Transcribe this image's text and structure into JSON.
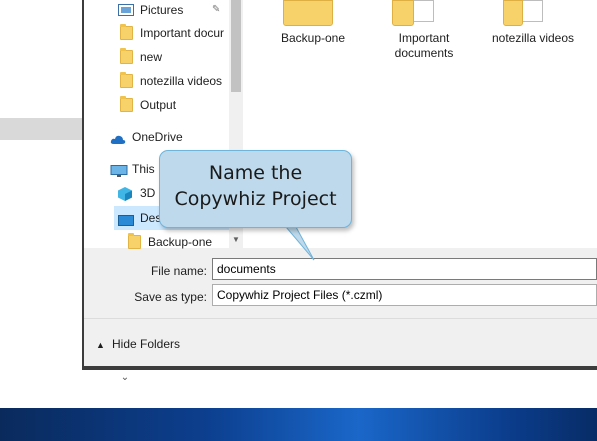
{
  "nav": {
    "items": [
      {
        "label": "Pictures",
        "icon": "pictures-icon",
        "pinned": true
      },
      {
        "label": "Important docur",
        "icon": "folder-icon"
      },
      {
        "label": "new",
        "icon": "folder-icon"
      },
      {
        "label": "notezilla videos",
        "icon": "folder-icon"
      },
      {
        "label": "Output",
        "icon": "folder-icon"
      },
      {
        "label": "OneDrive",
        "icon": "onedrive-icon"
      },
      {
        "label": "This",
        "icon": "this-pc-icon"
      },
      {
        "label": "3D",
        "icon": "3d-objects-icon"
      },
      {
        "label": "Des",
        "icon": "desktop-icon",
        "selected": true
      },
      {
        "label": "Backup-one",
        "icon": "folder-icon"
      }
    ]
  },
  "files": {
    "items": [
      {
        "label": "Backup-one"
      },
      {
        "label": "Important documents"
      },
      {
        "label": "notezilla videos"
      }
    ]
  },
  "form": {
    "filename_label": "File name:",
    "filename_value": "documents",
    "saveas_label": "Save as type:",
    "saveas_value": "Copywhiz Project Files (*.czml)"
  },
  "footer": {
    "hide_folders_label": "Hide Folders"
  },
  "callout": {
    "text_line1": "Name the",
    "text_line2": "Copywhiz Project"
  },
  "colors": {
    "callout_fill": "#bed9eb",
    "callout_border": "#6fb4db",
    "selection": "#cce8ff",
    "folder": "#f7d26b"
  }
}
